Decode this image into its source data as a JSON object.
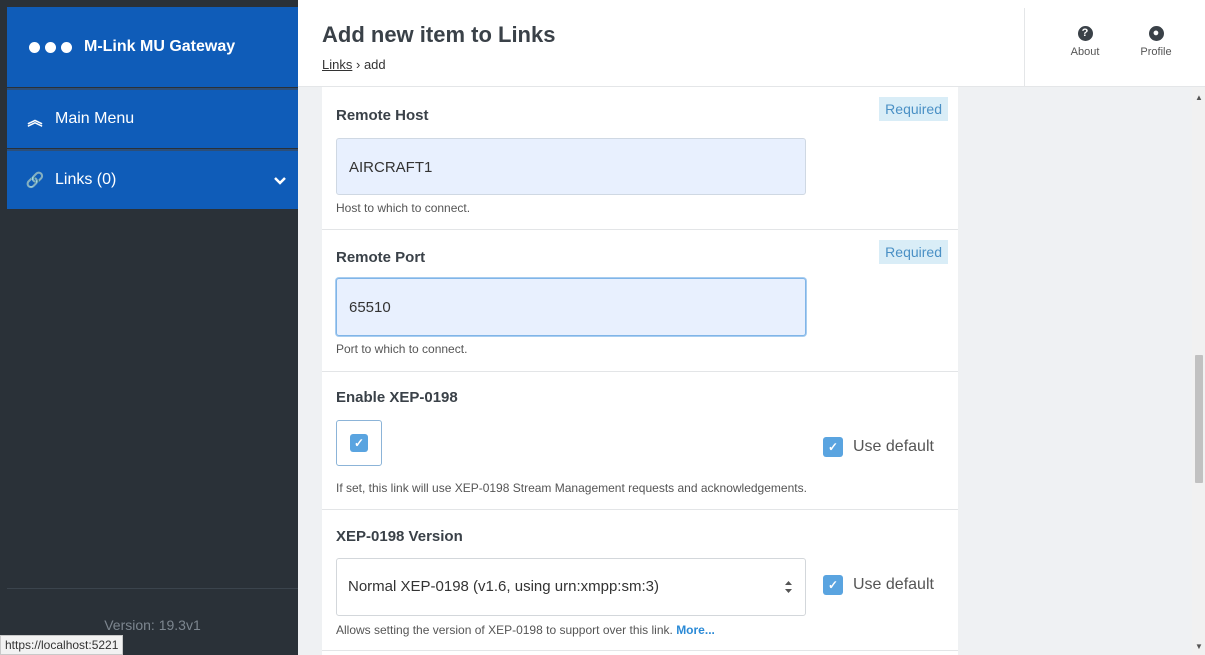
{
  "app": {
    "title": "M-Link MU Gateway",
    "version": "Version: 19.3v1"
  },
  "sidebar": {
    "items": [
      {
        "label": "Main Menu",
        "icon": "double-chevron-up-icon"
      },
      {
        "label": "Links (0)",
        "icon": "link-icon"
      }
    ]
  },
  "header": {
    "title": "Add new item to Links",
    "breadcrumb": {
      "link": "Links",
      "sep": "›",
      "current": "add"
    },
    "about_label": "About",
    "profile_label": "Profile"
  },
  "form": {
    "remote_host": {
      "label": "Remote Host",
      "required": "Required",
      "value": "AIRCRAFT1",
      "help": "Host to which to connect."
    },
    "remote_port": {
      "label": "Remote Port",
      "required": "Required",
      "value": "65510",
      "help": "Port to which to connect."
    },
    "enable_xep": {
      "label": "Enable XEP-0198",
      "checked": true,
      "use_default": "Use default",
      "help": "If set, this link will use XEP-0198 Stream Management requests and acknowledgements."
    },
    "xep_version": {
      "label": "XEP-0198 Version",
      "selected": "Normal XEP-0198 (v1.6, using urn:xmpp:sm:3)",
      "use_default": "Use default",
      "help": "Allows setting the version of XEP-0198 to support over this link.",
      "more": "More..."
    }
  },
  "status_url": "https://localhost:5221",
  "colors": {
    "brand": "#0f5cb8",
    "sidebar_bg": "#2a3138",
    "input_bg": "#e8f0fe",
    "required_bg": "#d9edf7",
    "checkbox": "#5aa4e0"
  }
}
